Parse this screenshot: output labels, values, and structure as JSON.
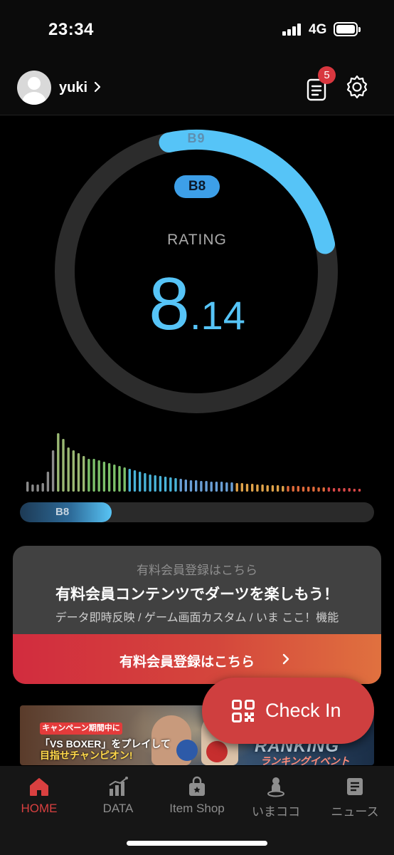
{
  "status_bar": {
    "time": "23:34",
    "network": "4G"
  },
  "header": {
    "username": "yuki",
    "notification_count": "5"
  },
  "rating": {
    "next_tier": "B9",
    "current_tier": "B8",
    "label": "RATING",
    "value_int": "8",
    "value_dec": ".14",
    "tier_progress_fraction": 0.25
  },
  "distribution": {
    "bar_heights": [
      14,
      10,
      10,
      12,
      28,
      58,
      82,
      74,
      62,
      58,
      54,
      50,
      46,
      46,
      44,
      42,
      40,
      38,
      36,
      34,
      32,
      30,
      28,
      26,
      24,
      23,
      22,
      21,
      20,
      19,
      18,
      17,
      16,
      16,
      15,
      15,
      14,
      14,
      14,
      13,
      13,
      12,
      12,
      11,
      11,
      10,
      10,
      9,
      9,
      9,
      8,
      8,
      8,
      8,
      7,
      7,
      7,
      6,
      6,
      6,
      5,
      5,
      5,
      5,
      4,
      4
    ],
    "colors": [
      "#8a8a8a",
      "#9ab873",
      "#7cc06a",
      "#49b3d8",
      "#6a9fd6",
      "#e0a34a",
      "#e06a3a",
      "#d94848"
    ]
  },
  "progress": {
    "label": "B8",
    "fill_fraction": 0.26
  },
  "membership": {
    "subtitle": "有料会員登録はこちら",
    "title": "有料会員コンテンツでダーツを楽しもう！",
    "features": "データ即時反映 / ゲーム画面カスタム / いま ここ！機能",
    "cta_label": "有料会員登録はこちら"
  },
  "banner": {
    "campaign_tag": "キャンペーン期間中に",
    "line1": "「VS BOXER」をプレイして",
    "line2": "目指せチャンピオン!",
    "ranking_title": "RANKING",
    "ranking_sub": "ランキングイベント"
  },
  "checkin": {
    "label": "Check In"
  },
  "nav": {
    "items": [
      {
        "label": "HOME",
        "icon": "home-icon",
        "active": true
      },
      {
        "label": "DATA",
        "icon": "chart-icon",
        "active": false
      },
      {
        "label": "Item Shop",
        "icon": "shop-bag-icon",
        "active": false
      },
      {
        "label": "いまココ",
        "icon": "location-person-icon",
        "active": false
      },
      {
        "label": "ニュース",
        "icon": "news-icon",
        "active": false
      }
    ]
  },
  "colors": {
    "accent_blue": "#56c4f7",
    "accent_red": "#d94040",
    "background": "#000000"
  }
}
